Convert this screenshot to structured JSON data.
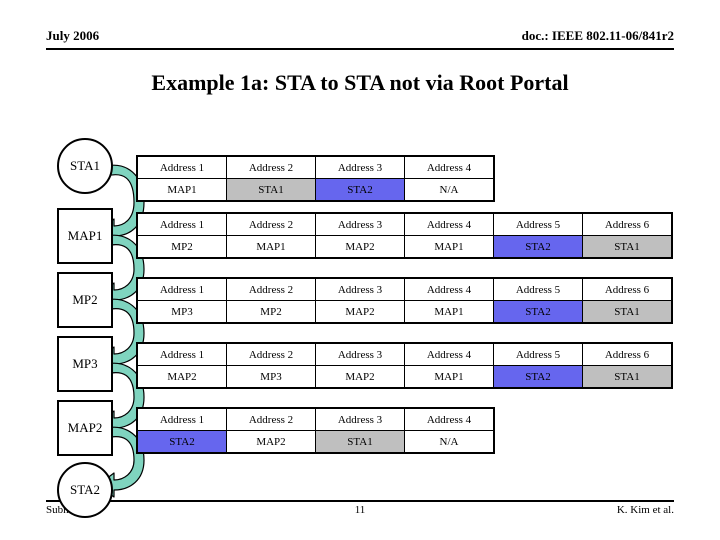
{
  "header": {
    "date": "July 2006",
    "doc": "doc.: IEEE 802.11-06/841r2"
  },
  "title": "Example 1a: STA to STA not via Root Portal",
  "colors": {
    "highlight_blue": "#6666ee",
    "highlight_gray": "#bfbfbf",
    "arrow_teal": "#7fd4bf",
    "node_fill": "#ffffff",
    "border": "#000000"
  },
  "diagram": {
    "nodes": [
      {
        "label": "STA1",
        "shape": "circle"
      },
      {
        "label": "MAP1",
        "shape": "square"
      },
      {
        "label": "MP2",
        "shape": "square"
      },
      {
        "label": "MP3",
        "shape": "square"
      },
      {
        "label": "MAP2",
        "shape": "square"
      },
      {
        "label": "STA2",
        "shape": "circle"
      }
    ],
    "arrows": [
      {
        "from": "STA1",
        "to": "MAP1"
      },
      {
        "from": "MAP1",
        "to": "MP2"
      },
      {
        "from": "MP2",
        "to": "MP3"
      },
      {
        "from": "MP3",
        "to": "MAP2"
      },
      {
        "from": "MAP2",
        "to": "STA2"
      }
    ]
  },
  "tables": [
    {
      "headers": [
        "Address 1",
        "Address 2",
        "Address 3",
        "Address 4"
      ],
      "values": [
        "MAP1",
        "STA1",
        "STA2",
        "N/A"
      ],
      "fills": [
        "white",
        "gray",
        "blue",
        "white"
      ]
    },
    {
      "headers": [
        "Address 1",
        "Address 2",
        "Address 3",
        "Address 4",
        "Address 5",
        "Address 6"
      ],
      "values": [
        "MP2",
        "MAP1",
        "MAP2",
        "MAP1",
        "STA2",
        "STA1"
      ],
      "fills": [
        "white",
        "white",
        "white",
        "white",
        "blue",
        "gray"
      ]
    },
    {
      "headers": [
        "Address 1",
        "Address 2",
        "Address 3",
        "Address 4",
        "Address 5",
        "Address 6"
      ],
      "values": [
        "MP3",
        "MP2",
        "MAP2",
        "MAP1",
        "STA2",
        "STA1"
      ],
      "fills": [
        "white",
        "white",
        "white",
        "white",
        "blue",
        "gray"
      ]
    },
    {
      "headers": [
        "Address 1",
        "Address 2",
        "Address 3",
        "Address 4",
        "Address 5",
        "Address 6"
      ],
      "values": [
        "MAP2",
        "MP3",
        "MAP2",
        "MAP1",
        "STA2",
        "STA1"
      ],
      "fills": [
        "white",
        "white",
        "white",
        "white",
        "blue",
        "gray"
      ]
    },
    {
      "headers": [
        "Address 1",
        "Address 2",
        "Address 3",
        "Address 4"
      ],
      "values": [
        "STA2",
        "MAP2",
        "STA1",
        "N/A"
      ],
      "fills": [
        "blue",
        "white",
        "gray",
        "white"
      ]
    }
  ],
  "footer": {
    "left": "Submission",
    "page": "11",
    "right": "K. Kim et al."
  }
}
